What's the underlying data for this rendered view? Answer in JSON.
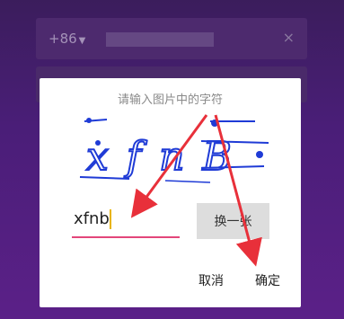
{
  "background": {
    "country_code": "+86",
    "close_symbol": "×"
  },
  "dialog": {
    "title": "请输入图片中的字符",
    "captcha_text": "xfnB",
    "input_value": "xfnb",
    "refresh_label": "换一张",
    "cancel_label": "取消",
    "confirm_label": "确定"
  },
  "colors": {
    "input_underline": "#e3467a",
    "arrow": "#e8303a",
    "captcha_ink": "#1f3bd6"
  }
}
